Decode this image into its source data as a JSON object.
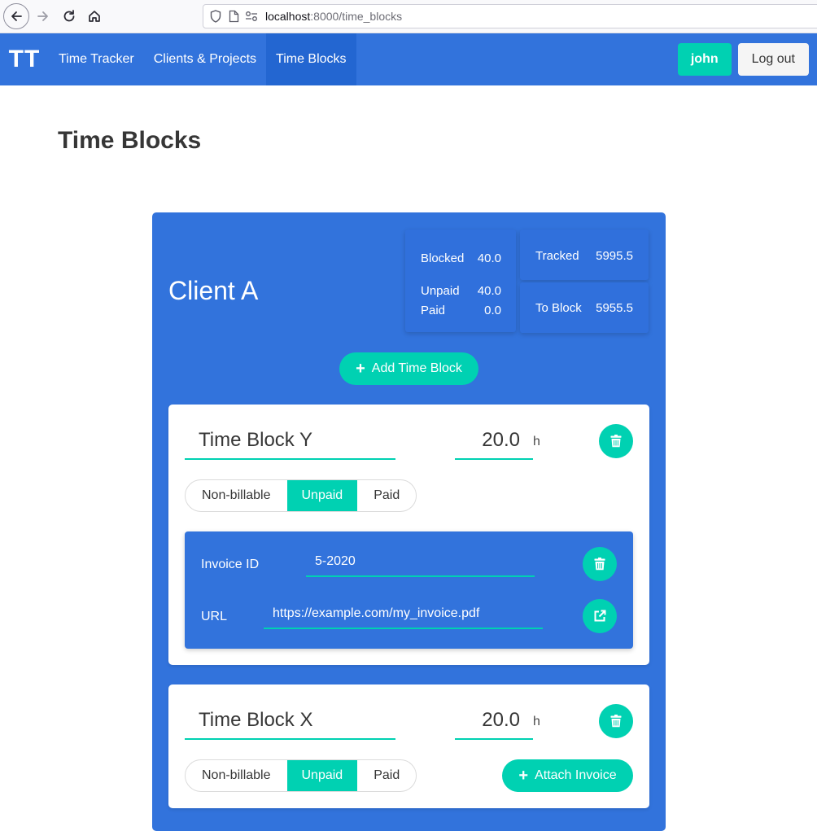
{
  "browser": {
    "url_host": "localhost",
    "url_path": ":8000/time_blocks"
  },
  "navbar": {
    "brand": "TT",
    "items": [
      {
        "label": "Time Tracker"
      },
      {
        "label": "Clients & Projects"
      },
      {
        "label": "Time Blocks",
        "active": true
      }
    ],
    "user_label": "john",
    "logout_label": "Log out"
  },
  "page": {
    "title": "Time Blocks"
  },
  "client": {
    "name": "Client A",
    "stats": {
      "blocked_label": "Blocked",
      "blocked_value": "40.0",
      "unpaid_label": "Unpaid",
      "unpaid_value": "40.0",
      "paid_label": "Paid",
      "paid_value": "0.0",
      "tracked_label": "Tracked",
      "tracked_value": "5995.5",
      "to_block_label": "To Block",
      "to_block_value": "5955.5"
    },
    "add_block_label": "Add Time Block",
    "blocks": [
      {
        "name": "Time Block Y",
        "hours": "20.0",
        "unit": "h",
        "status_options": [
          "Non-billable",
          "Unpaid",
          "Paid"
        ],
        "status_selected": "Unpaid",
        "invoice": {
          "id_label": "Invoice ID",
          "id_value": "5-2020",
          "url_label": "URL",
          "url_value": "https://example.com/my_invoice.pdf"
        }
      },
      {
        "name": "Time Block X",
        "hours": "20.0",
        "unit": "h",
        "status_options": [
          "Non-billable",
          "Unpaid",
          "Paid"
        ],
        "status_selected": "Unpaid",
        "attach_label": "Attach Invoice"
      }
    ]
  },
  "colors": {
    "primary": "#3273dc",
    "accent": "#00d1b2"
  }
}
